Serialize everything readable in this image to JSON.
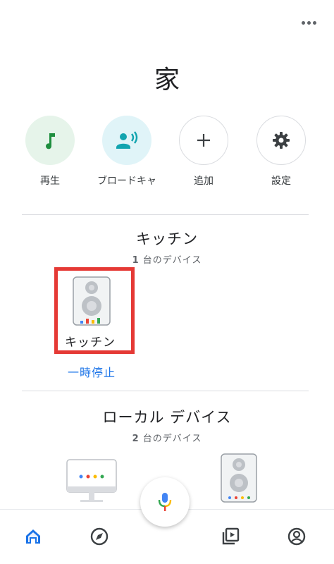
{
  "header": {
    "title": "家",
    "more_icon": "more-horiz-icon"
  },
  "actions": [
    {
      "label": "再生",
      "icon": "music-note-icon",
      "color": "#1e8e3e"
    },
    {
      "label": "ブロードキャ",
      "icon": "broadcast-icon",
      "color": "#12a4af"
    },
    {
      "label": "追加",
      "icon": "plus-icon",
      "color": "#5f6368"
    },
    {
      "label": "設定",
      "icon": "gear-icon",
      "color": "#5f6368"
    }
  ],
  "rooms": [
    {
      "title": "キッチン",
      "subtitle_count": "1",
      "subtitle_text": "台のデバイス",
      "devices": [
        {
          "name": "キッチン",
          "action": "一時停止",
          "icon": "speaker-icon"
        }
      ]
    },
    {
      "title": "ローカル デバイス",
      "subtitle_count": "2",
      "subtitle_text": "台のデバイス",
      "devices": [
        {
          "icon": "display-icon"
        },
        {
          "icon": "speaker-icon"
        }
      ]
    }
  ],
  "bottom_nav": [
    {
      "icon": "home-icon",
      "active": true
    },
    {
      "icon": "explore-icon",
      "active": false
    },
    {
      "icon": "media-icon",
      "active": false
    },
    {
      "icon": "account-icon",
      "active": false
    }
  ],
  "fab": {
    "icon": "mic-icon"
  },
  "colors": {
    "accent": "#1a73e8",
    "highlight": "#e53935",
    "google_blue": "#4285f4",
    "google_red": "#ea4335",
    "google_yellow": "#fbbc04",
    "google_green": "#34a853"
  }
}
